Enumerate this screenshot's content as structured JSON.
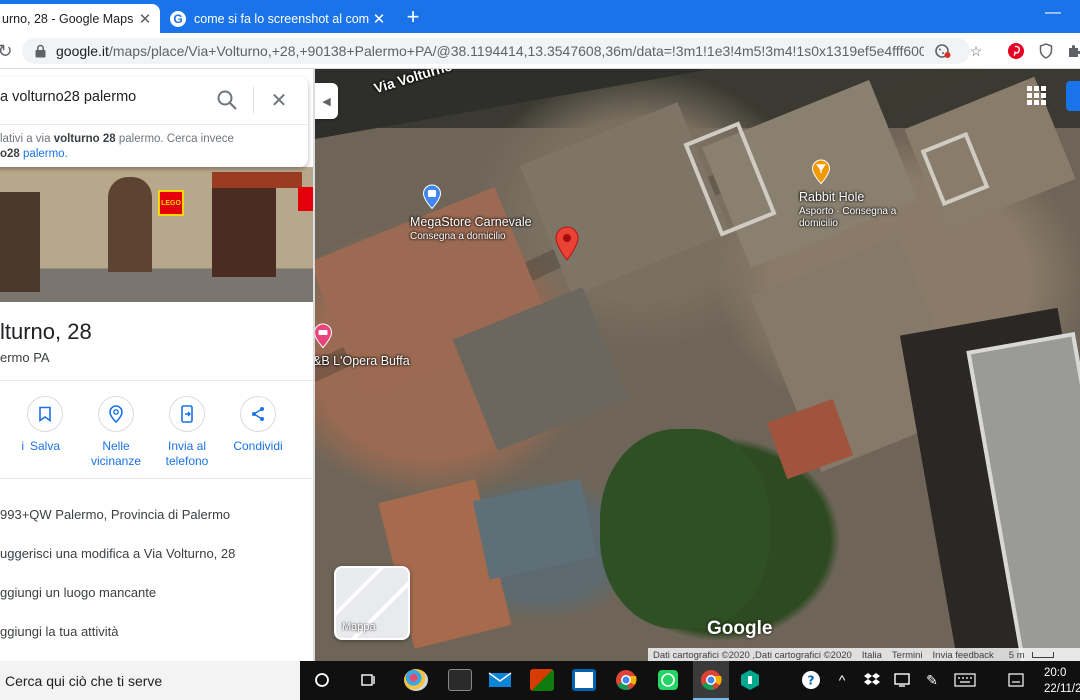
{
  "browser": {
    "tabs": [
      {
        "title": "urno, 28 - Google Maps",
        "active": true
      },
      {
        "title": "come si fa lo screenshot al comp",
        "active": false
      }
    ],
    "url_host": "google.it",
    "url_path": "/maps/place/Via+Volturno,+28,+90138+Palermo+PA/@38.1194414,13.3547608,36m/data=!3m1!1e3!4m5!3m4!1s0x1319ef5e4fff6009:..."
  },
  "search": {
    "query": "a volturno28 palermo",
    "suggestion_prefix": "lativi a via ",
    "suggestion_bold": "volturno 28",
    "suggestion_mid": " palermo. Cerca invece",
    "suggestion_link_bold": "o28",
    "suggestion_link_rest": " palermo."
  },
  "place": {
    "title": "lturno, 28",
    "subtitle": "ermo PA",
    "actions": [
      {
        "label": "i",
        "icon": "directions-icon"
      },
      {
        "label": "Salva",
        "icon": "bookmark-icon"
      },
      {
        "label": "Nelle vicinanze",
        "icon": "nearby-icon"
      },
      {
        "label": "Invia al telefono",
        "icon": "send-to-phone-icon"
      },
      {
        "label": "Condividi",
        "icon": "share-icon"
      }
    ],
    "info_rows": [
      "993+QW Palermo, Provincia di Palermo",
      "uggerisci una modifica a Via Volturno, 28",
      "ggiungi un luogo mancante",
      "ggiungi la tua attività"
    ]
  },
  "map": {
    "street": "Via Volturno",
    "pois": [
      {
        "name": "MegaStore Carnevale",
        "sub": "Consegna a domicilio"
      },
      {
        "name": "Rabbit Hole",
        "sub": "Asporto · Consegna a domicilio"
      },
      {
        "name": "&B L'Opera Buffa",
        "sub": ""
      }
    ],
    "layer_label": "Mappa",
    "logo": "Google",
    "footer": [
      "Dati cartografici ©2020 ,Dati cartografici ©2020",
      "Italia",
      "Termini",
      "Invia feedback",
      "5 m"
    ]
  },
  "taskbar": {
    "search_placeholder": "Cerca qui ciò che ti serve",
    "time": "20:0",
    "date": "22/11/2"
  },
  "colors": {
    "accent": "#1a73e8",
    "pin_red": "#ea4335",
    "poi_blue": "#4285f4",
    "poi_orange": "#f29900",
    "poi_pink": "#e8447c"
  }
}
